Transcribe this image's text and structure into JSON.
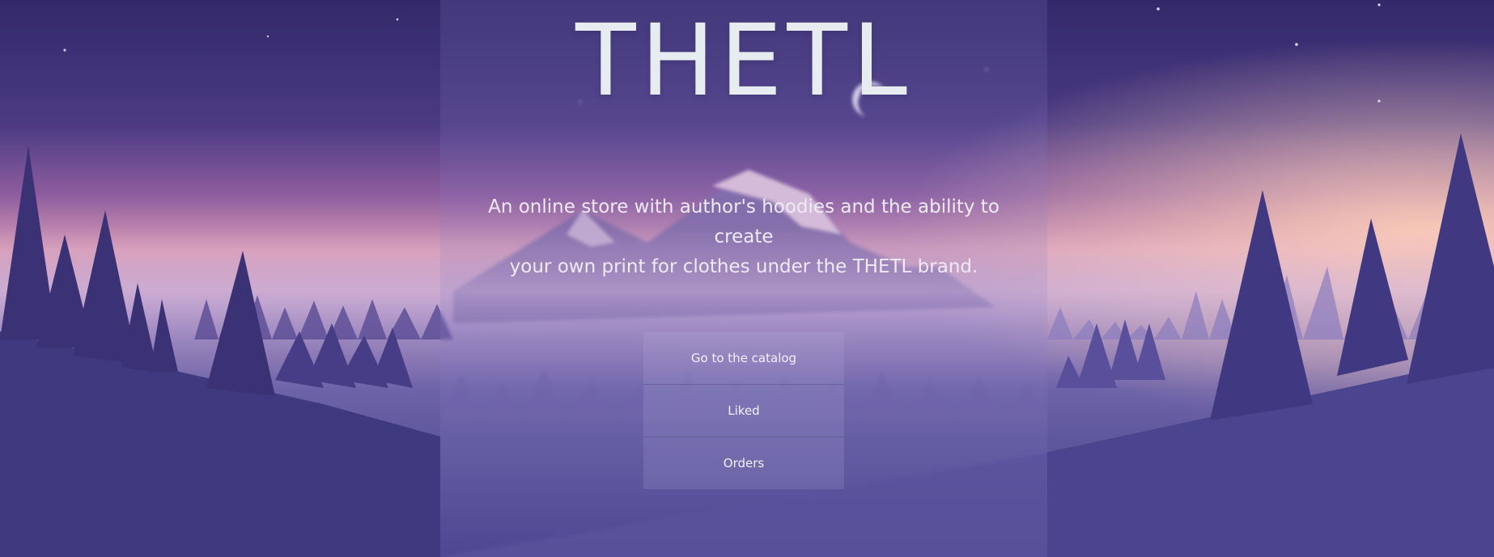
{
  "brand": {
    "logo_text": "THETL"
  },
  "hero": {
    "tagline_line1": "An online store with author's hoodies and the ability to create",
    "tagline_line2": "your own print for clothes under the THETL brand."
  },
  "menu": {
    "items": [
      {
        "label": "Go to the catalog"
      },
      {
        "label": "Liked"
      },
      {
        "label": "Orders"
      }
    ]
  },
  "colors": {
    "sky_top": "#3a2d6c",
    "sky_glow": "#f2a9b8",
    "tree_dark": "#3e3578",
    "ground": "#44408a",
    "text": "#e6ecef"
  }
}
